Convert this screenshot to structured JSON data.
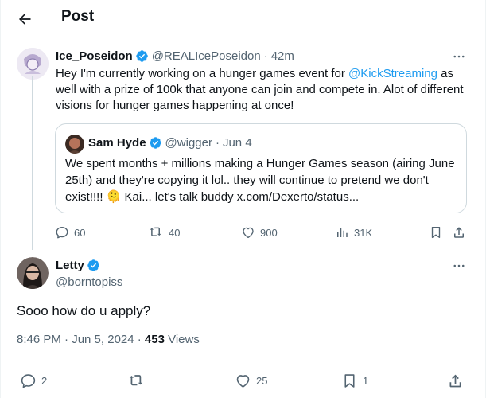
{
  "header": {
    "title": "Post"
  },
  "parent_post": {
    "display_name": "Ice_Poseidon",
    "handle": "@REALIcePoseidon",
    "separator": "·",
    "time": "42m",
    "text_part1": "Hey I'm currently working on a hunger games event for ",
    "mention": "@KickStreaming",
    "text_part2": " as well with a prize of 100k that anyone can join and compete in. Alot of different visions for hunger games happening at once!",
    "quote": {
      "display_name": "Sam Hyde",
      "handle": "@wigger",
      "separator": "·",
      "time": "Jun 4",
      "text_part1": "We spent months + millions making a Hunger Games season (airing June 25th) and they're copying it lol.. they will continue to pretend we don't exist!!!! ",
      "emoji": "🫠",
      "text_part2": " Kai... let's talk buddy x.com/Dexerto/status..."
    },
    "stats": {
      "replies": "60",
      "reposts": "40",
      "likes": "900",
      "views": "31K"
    }
  },
  "main_post": {
    "display_name": "Letty",
    "handle": "@borntopiss",
    "text": "Sooo how do u apply?",
    "timestamp": "8:46 PM · Jun 5, 2024 · ",
    "views_count": "453",
    "views_label": " Views",
    "stats": {
      "replies": "2",
      "reposts": "",
      "likes": "25",
      "bookmarks": "1"
    }
  },
  "colors": {
    "accent": "#1d9bf0",
    "muted": "#536471",
    "border": "#cfd9de",
    "text": "#0f1419"
  }
}
